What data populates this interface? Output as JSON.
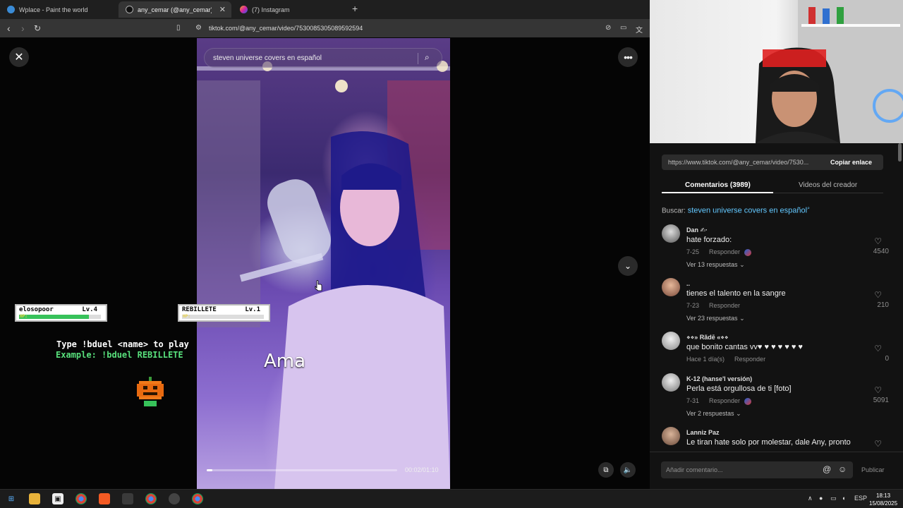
{
  "browser": {
    "tabs": [
      {
        "title": "Wplace - Paint the world"
      },
      {
        "title": "any_cemar (@any_cemar) ofi"
      },
      {
        "title": "(7) Instagram"
      }
    ],
    "url": "tiktok.com/@any_cemar/video/7530085305089592594"
  },
  "video": {
    "search_text": "steven universe covers en español",
    "timecode": "00:02/01:10",
    "progress": 0.03,
    "caption": "Ama"
  },
  "overlay": {
    "player1": {
      "name": "elosopoor",
      "level": "Lv.4",
      "hp": 0.85
    },
    "player2": {
      "name": "REBILLETE",
      "level": "Lv.1",
      "hp": 0.0
    },
    "hp_label": "HP:",
    "instruction": "Type !bduel <name> to play",
    "example": "Example: !bduel REBILLETE"
  },
  "panel": {
    "copy_url": "https://www.tiktok.com/@any_cemar/video/7530...",
    "copy_label": "Copiar enlace",
    "tabs": [
      "Comentarios (3989)",
      "Videos del creador"
    ],
    "search_prefix": "Buscar:",
    "search_query": "steven universe covers en español",
    "comments": [
      {
        "user": "Dan ✍·",
        "text": "hate forzado:",
        "date": "7-25",
        "reply": "Responder",
        "likes": "4540",
        "replies": "Ver 13 respuestas"
      },
      {
        "user": "..",
        "text": "tienes el talento en la sangre",
        "date": "7-23",
        "reply": "Responder",
        "likes": "210",
        "replies": "Ver 23 respuestas"
      },
      {
        "user": "⋄⋄» Rãdē «⋄⋄",
        "text": "que bonito cantas vv♥ ♥ ♥ ♥ ♥ ♥ ♥",
        "date": "Hace 1 día(s)",
        "reply": "Responder",
        "likes": "0",
        "replies": ""
      },
      {
        "user": "K-12 (hanse'l versión)",
        "text": "Perla está orgullosa de ti [foto]",
        "date": "7-31",
        "reply": "Responder",
        "likes": "5091",
        "replies": "Ver 2 respuestas"
      },
      {
        "user": "Lanniz Paz",
        "text": "Le tiran hate solo por molestar, dale Any, pronto",
        "date": "",
        "reply": "",
        "likes": "",
        "replies": ""
      }
    ],
    "input_placeholder": "Añadir comentario...",
    "publish_label": "Publicar"
  },
  "taskbar": {
    "lang": "ESP",
    "time": "18:13",
    "date": "15/08/2025"
  },
  "colors": {
    "accent_link": "#63c8ff",
    "panel_bg": "#121212",
    "hp_green": "#37c25a",
    "instruction_white": "#ffffff",
    "example_green": "#58e07c"
  }
}
